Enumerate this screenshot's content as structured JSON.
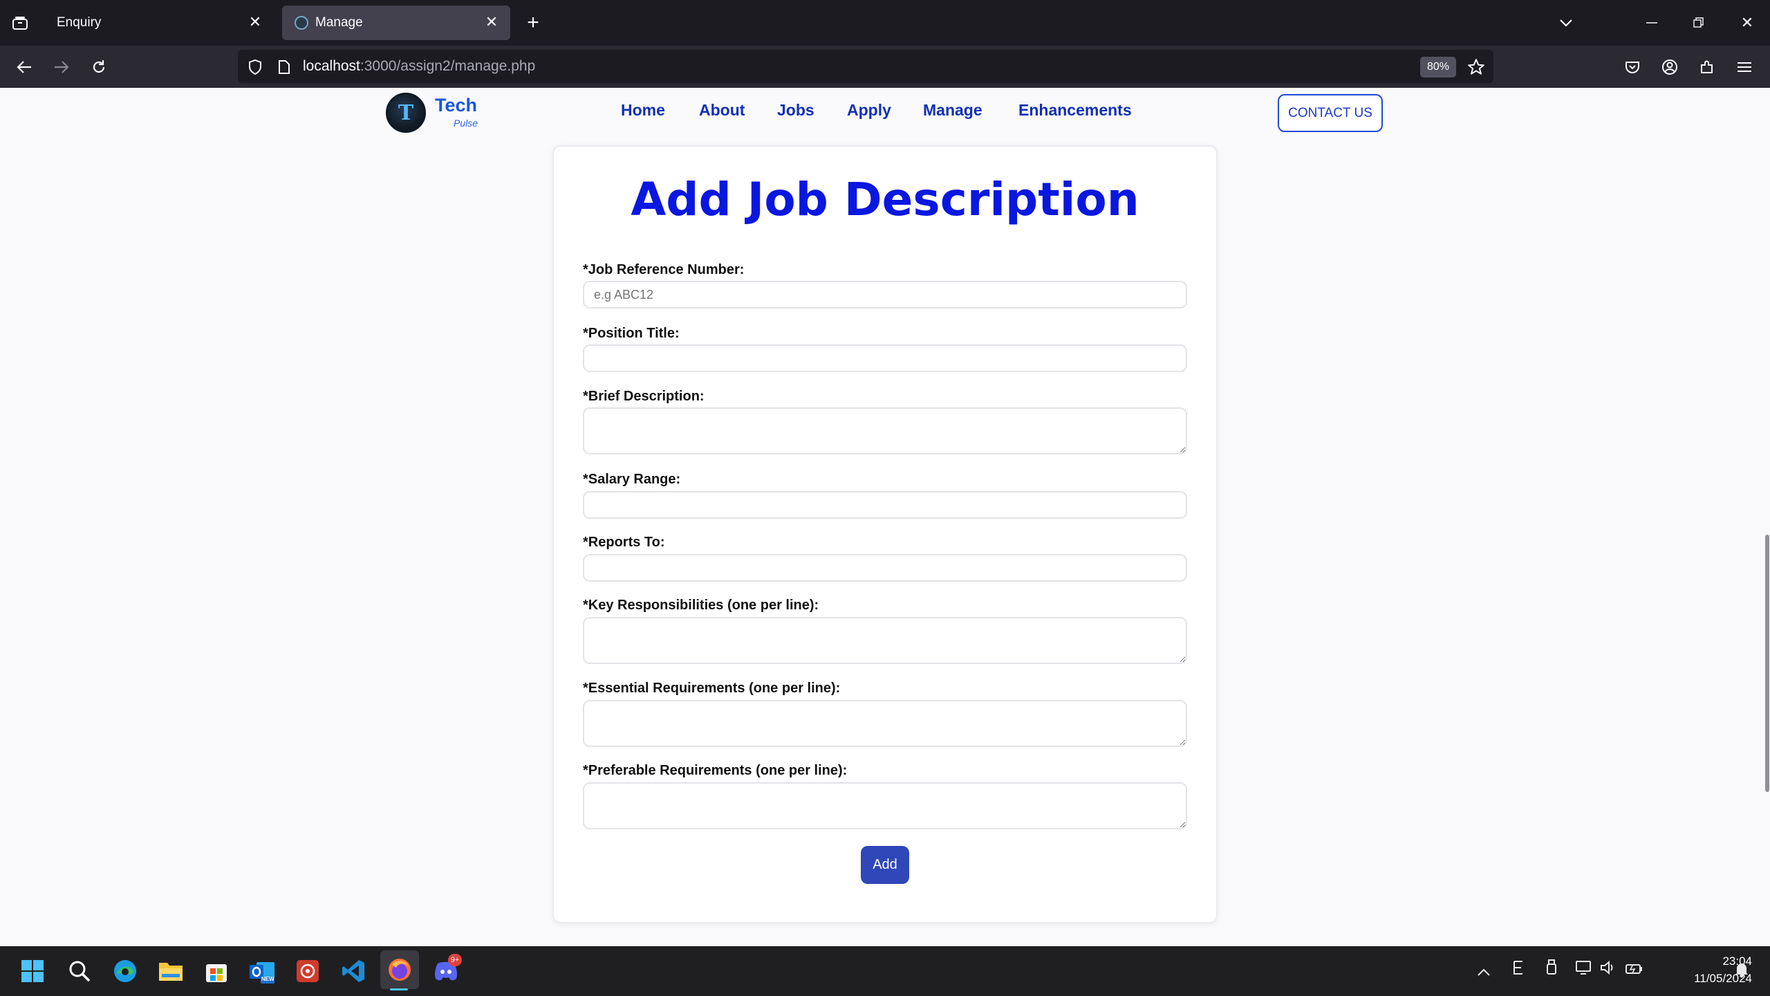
{
  "browser": {
    "tabs": [
      {
        "title": "Enquiry",
        "active": false
      },
      {
        "title": "Manage",
        "active": true
      }
    ],
    "url_host": "localhost",
    "url_path": ":3000/assign2/manage.php",
    "zoom": "80%"
  },
  "site": {
    "logo_main": "Tech",
    "logo_sub": "Pulse",
    "logo_mark": "T",
    "nav": [
      "Home",
      "About",
      "Jobs",
      "Apply",
      "Manage",
      "Enhancements"
    ],
    "contact": "CONTACT US"
  },
  "form": {
    "title": "Add Job Description",
    "fields": [
      {
        "label": "*Job Reference Number:",
        "placeholder": "e.g ABC12",
        "value": ""
      },
      {
        "label": "*Position Title:",
        "placeholder": "",
        "value": ""
      },
      {
        "label": "*Brief Description:",
        "placeholder": "",
        "value": ""
      },
      {
        "label": "*Salary Range:",
        "placeholder": "",
        "value": ""
      },
      {
        "label": "*Reports To:",
        "placeholder": "",
        "value": ""
      },
      {
        "label": "*Key Responsibilities (one per line):",
        "placeholder": "",
        "value": ""
      },
      {
        "label": "*Essential Requirements (one per line):",
        "placeholder": "",
        "value": ""
      },
      {
        "label": "*Preferable Requirements (one per line):",
        "placeholder": "",
        "value": ""
      }
    ],
    "submit": "Add"
  },
  "taskbar": {
    "apps": [
      "start-icon",
      "search-icon",
      "edge-icon",
      "file-explorer-icon",
      "store-icon",
      "outlook-icon",
      "app-red-icon",
      "vscode-icon",
      "firefox-icon",
      "discord-icon"
    ],
    "discord_badge": "9+",
    "outlook_badge": "NEW",
    "time": "23:04",
    "date": "11/05/2024"
  },
  "colors": {
    "accent": "#0a17e0",
    "nav": "#1030b8",
    "button": "#2f47b8"
  }
}
